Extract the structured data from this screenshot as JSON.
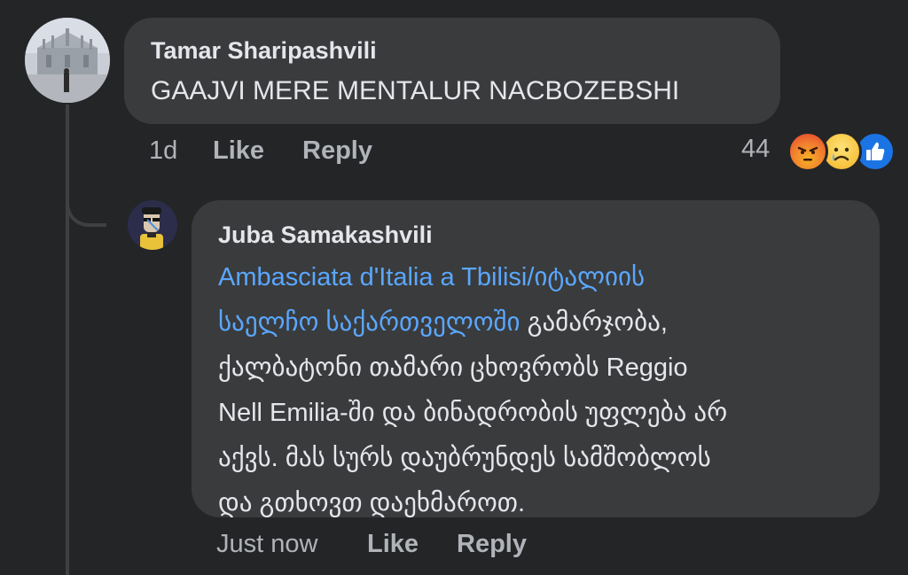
{
  "comment": {
    "author": "Tamar Sharipashvili",
    "text": "GAAJVI MERE MENTALUR NACBOZEBSHI",
    "time": "1d",
    "like_label": "Like",
    "reply_label": "Reply",
    "reaction_count": "44",
    "reactions": [
      "angry-reaction-icon",
      "sad-reaction-icon",
      "like-reaction-icon"
    ]
  },
  "reply": {
    "author": "Juba Samakashvili",
    "mention_line1": "Ambasciata d'Italia a Tbilisi/იტალიის",
    "mention_line2": "საელჩო საქართველოში",
    "text_line2_rest": " გამარჯობა,",
    "text_line3": "ქალბატონი თამარი ცხოვრობს Reggio",
    "text_line4": "Nell Emilia-ში და ბინადრობის უფლება არ",
    "text_line5": "აქვს. მას სურს დაუბრუნდეს სამშობლოს",
    "text_line6": "და გთხოვთ დაეხმაროთ.",
    "time": "Just now",
    "like_label": "Like",
    "reply_label": "Reply"
  },
  "colors": {
    "background": "#242527",
    "bubble": "#3a3b3c",
    "mention": "#5aa7ff",
    "meta_text": "#b0b3b8"
  }
}
